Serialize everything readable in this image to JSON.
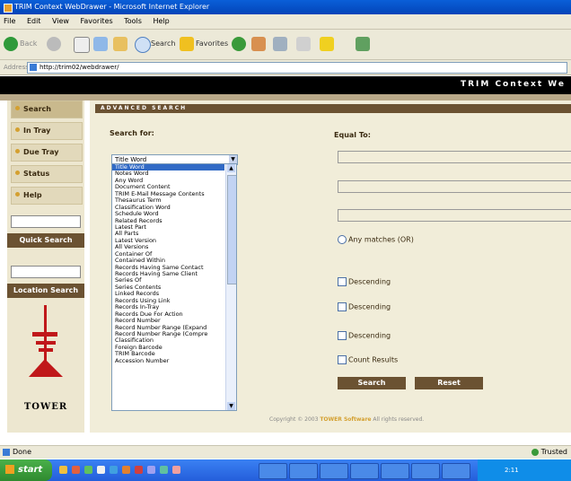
{
  "window": {
    "title": "TRIM Context WebDrawer - Microsoft Internet Explorer"
  },
  "menu": [
    "File",
    "Edit",
    "View",
    "Favorites",
    "Tools",
    "Help"
  ],
  "toolbar": {
    "back": "Back",
    "search": "Search",
    "favorites": "Favorites"
  },
  "address": {
    "label": "Address",
    "url": "http://trim02/webdrawer/"
  },
  "banner": {
    "title": "TRIM Context We"
  },
  "nav": {
    "items": [
      {
        "label": "Search"
      },
      {
        "label": "In Tray"
      },
      {
        "label": "Due Tray"
      },
      {
        "label": "Status"
      },
      {
        "label": "Help"
      }
    ],
    "quick_search": "Quick Search",
    "location_search": "Location Search",
    "logo_text": "TOWER"
  },
  "advanced": {
    "header": "ADVANCED SEARCH",
    "search_for_label": "Search for:",
    "equal_to_label": "Equal To:",
    "selected": "Title Word",
    "options": [
      "Title Word",
      "Notes Word",
      "Any Word",
      "Document Content",
      "TRIM E-Mail Message Contents",
      "Thesaurus Term",
      "Classification Word",
      "Schedule Word",
      "Related Records",
      "Latest Part",
      "All Parts",
      "Latest Version",
      "All Versions",
      "Container Of",
      "Contained Within",
      "Records Having Same Contact",
      "Records Having Same Client",
      "Series Of",
      "Series Contents",
      "Linked Records",
      "Records Using Link",
      "Records In-Tray",
      "Records Due For Action",
      "Record Number",
      "Record Number Range (Expand",
      "Record Number Range (Compre",
      "Classification",
      "Foreign Barcode",
      "TRIM Barcode",
      "Accession Number"
    ],
    "any_matches": "Any matches (OR)",
    "descending": "Descending",
    "count_results": "Count Results",
    "search_btn": "Search",
    "reset_btn": "Reset",
    "copyright_pre": "Copyright © 2003",
    "copyright_brand": "TOWER Software",
    "copyright_post": "All rights reserved."
  },
  "status": {
    "done": "Done",
    "zone": "Trusted"
  },
  "taskbar": {
    "start": "start",
    "tray": "2:11"
  }
}
